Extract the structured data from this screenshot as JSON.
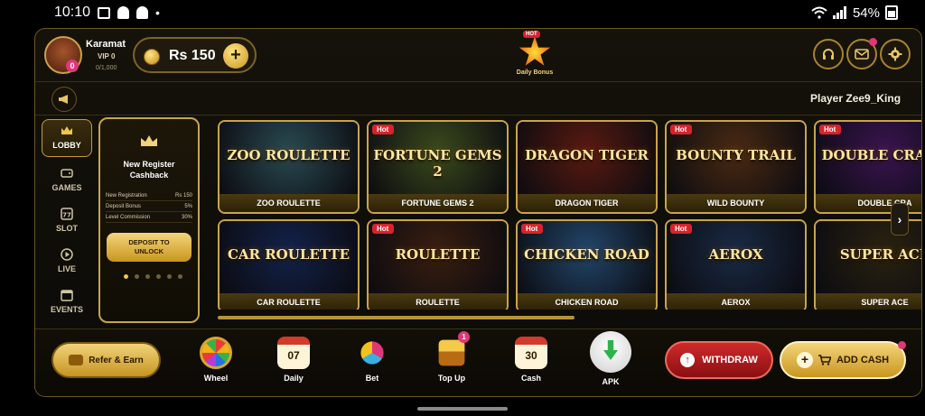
{
  "status_bar": {
    "time": "10:10",
    "battery": "54%",
    "dot": "•"
  },
  "header": {
    "username": "Karamat",
    "vip_level": "VIP 0",
    "vip_progress": "0/1,000",
    "avatar_badge": "0",
    "balance": "Rs 150",
    "balance_add_label": "+",
    "daily_bonus_label": "Daily Bonus",
    "daily_bonus_tag": "HOT"
  },
  "marquee": {
    "text": "Player Zee9_King "
  },
  "sidebar": {
    "items": [
      {
        "label": "LOBBY",
        "icon": "crown-icon",
        "active": true
      },
      {
        "label": "GAMES",
        "icon": "gamepad-icon",
        "active": false
      },
      {
        "label": "SLOT",
        "icon": "slot-77-icon",
        "active": false
      },
      {
        "label": "LIVE",
        "icon": "play-circle-icon",
        "active": false
      },
      {
        "label": "EVENTS",
        "icon": "calendar-icon",
        "active": false
      }
    ]
  },
  "promo": {
    "title_line1": "New Register",
    "title_line2": "Cashback",
    "rows": [
      {
        "label": "New Registration",
        "value": "Rs 150"
      },
      {
        "label": "Deposit Bonus",
        "value": "5%"
      },
      {
        "label": "Level Commission",
        "value": "30%"
      }
    ],
    "button_line1": "DEPOSIT TO",
    "button_line2": "UNLOCK"
  },
  "games": {
    "hot_label": "Hot",
    "row1": [
      {
        "name": "ZOO ROULETTE",
        "art_title": "ZOO ROULETTE",
        "hot": false,
        "bg": "#2a4a52"
      },
      {
        "name": "FORTUNE GEMS 2",
        "art_title": "FORTUNE GEMS 2",
        "hot": true,
        "bg": "#3b4a1c"
      },
      {
        "name": "DRAGON TIGER",
        "art_title": "DRAGON TIGER",
        "hot": false,
        "bg": "#5a1a10"
      },
      {
        "name": "WILD BOUNTY",
        "art_title": "BOUNTY TRAIL",
        "hot": true,
        "bg": "#4a2a12"
      },
      {
        "name": "DOUBLE CRA",
        "art_title": "DOUBLE CRASH",
        "hot": true,
        "bg": "#3a1450"
      }
    ],
    "row2": [
      {
        "name": "CAR ROULETTE",
        "art_title": "CAR ROULETTE",
        "hot": false,
        "bg": "#13224a"
      },
      {
        "name": "ROULETTE",
        "art_title": "ROULETTE",
        "hot": true,
        "bg": "#3a1e10"
      },
      {
        "name": "CHICKEN ROAD",
        "art_title": "CHICKEN ROAD",
        "hot": true,
        "bg": "#22466a"
      },
      {
        "name": "AEROX",
        "art_title": "AEROX",
        "hot": true,
        "bg": "#1a2a44"
      },
      {
        "name": "SUPER ACE",
        "art_title": "SUPER ACE",
        "hot": false,
        "bg": "#2a2210"
      }
    ]
  },
  "bottom": {
    "refer_label": "Refer & Earn",
    "wheel_label": "Wheel",
    "daily_label": "Daily",
    "daily_value": "07",
    "bet_label": "Bet",
    "topup_label": "Top Up",
    "topup_badge": "1",
    "cash_label": "Cash",
    "cash_value": "30",
    "apk_label": "APK",
    "withdraw_label": "WITHDRAW",
    "add_cash_label": "ADD CASH"
  }
}
